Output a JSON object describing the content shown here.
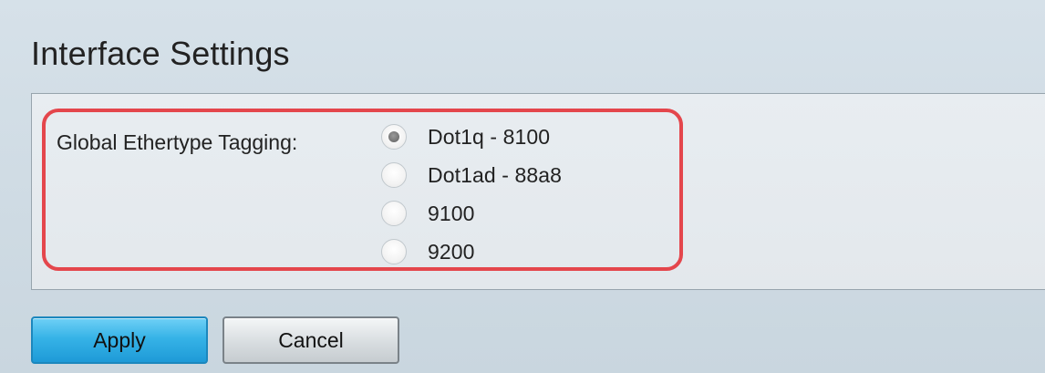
{
  "page": {
    "title": "Interface Settings"
  },
  "form": {
    "label": "Global Ethertype Tagging:",
    "selected": "Dot1q - 8100",
    "options": [
      {
        "label": "Dot1q - 8100",
        "checked": true
      },
      {
        "label": "Dot1ad - 88a8",
        "checked": false
      },
      {
        "label": "9100",
        "checked": false
      },
      {
        "label": "9200",
        "checked": false
      }
    ]
  },
  "buttons": {
    "apply_label": "Apply",
    "cancel_label": "Cancel"
  },
  "colors": {
    "highlight": "#e4464c",
    "apply_button": "#36b3e7"
  }
}
